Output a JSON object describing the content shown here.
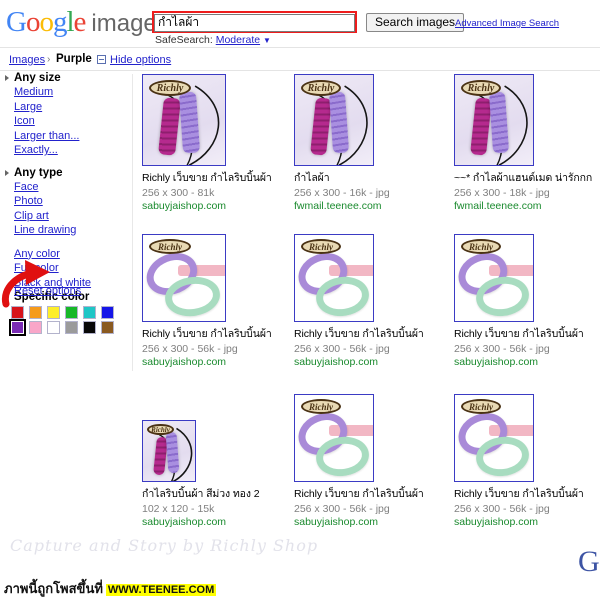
{
  "header": {
    "logo_text": "Google",
    "logo_letters": [
      "G",
      "o",
      "o",
      "g",
      "l",
      "e"
    ],
    "logo_suffix": "images",
    "search_value": "กำไลผ้า",
    "search_placeholder": "",
    "search_button": "Search images",
    "advanced_link": "Advanced Image Search",
    "safesearch_label": "SafeSearch:",
    "safesearch_value": "Moderate",
    "safesearch_caret": "▼"
  },
  "breadcrumb": {
    "root": "Images",
    "separator": "›",
    "current": "Purple",
    "hide_options": "Hide options"
  },
  "sidebar": {
    "groups": [
      {
        "head": "Any size",
        "links": [
          "Medium",
          "Large",
          "Icon",
          "Larger than...",
          "Exactly..."
        ]
      },
      {
        "head": "Any type",
        "links": [
          "Face",
          "Photo",
          "Clip art",
          "Line drawing"
        ]
      }
    ],
    "color_links": [
      "Any color",
      "Full color",
      "Black and white"
    ],
    "specific_color_head": "Specific color",
    "swatch_rows": [
      [
        {
          "name": "red",
          "hex": "#d7131a",
          "selected": false
        },
        {
          "name": "orange",
          "hex": "#f59b1b",
          "selected": false
        },
        {
          "name": "yellow",
          "hex": "#fdee2a",
          "selected": false
        },
        {
          "name": "green",
          "hex": "#17b828",
          "selected": false
        },
        {
          "name": "teal",
          "hex": "#1fc6c6",
          "selected": false
        },
        {
          "name": "blue",
          "hex": "#1515e8",
          "selected": false
        }
      ],
      [
        {
          "name": "purple",
          "hex": "#7a2bb5",
          "selected": true
        },
        {
          "name": "pink",
          "hex": "#f9a6c8",
          "selected": false
        },
        {
          "name": "white",
          "hex": "#ffffff",
          "selected": false
        },
        {
          "name": "gray",
          "hex": "#9b9b9b",
          "selected": false
        },
        {
          "name": "black",
          "hex": "#080808",
          "selected": false
        },
        {
          "name": "brown",
          "hex": "#8a5a20",
          "selected": false
        }
      ]
    ],
    "reset_options": "Reset options"
  },
  "results": [
    [
      {
        "title": "Richly เว็บขาย กำไลริบบิ้นผ้า",
        "dims": "256 x 300 - 81k",
        "site": "sabuyjaishop.com",
        "art": "bands",
        "thumb_w": 84,
        "thumb_h": 92
      },
      {
        "title": "กำไลผ้า",
        "dims": "256 x 300 - 16k - jpg",
        "site": "fwmail.teenee.com",
        "art": "bands",
        "thumb_w": 80,
        "thumb_h": 92
      },
      {
        "title": "~~* กำไลผ้าแฮนด์เมด น่ารักกก",
        "dims": "256 x 300 - 18k - jpg",
        "site": "fwmail.teenee.com",
        "art": "bands",
        "thumb_w": 80,
        "thumb_h": 92
      }
    ],
    [
      {
        "title": "Richly เว็บขาย กำไลริบบิ้นผ้า",
        "dims": "256 x 300 - 56k - jpg",
        "site": "sabuyjaishop.com",
        "art": "rings",
        "thumb_w": 84,
        "thumb_h": 88
      },
      {
        "title": "Richly เว็บขาย กำไลริบบิ้นผ้า",
        "dims": "256 x 300 - 56k - jpg",
        "site": "sabuyjaishop.com",
        "art": "rings",
        "thumb_w": 80,
        "thumb_h": 88
      },
      {
        "title": "Richly เว็บขาย กำไลริบบิ้นผ้า",
        "dims": "256 x 300 - 56k - jpg",
        "site": "sabuyjaishop.com",
        "art": "rings",
        "thumb_w": 80,
        "thumb_h": 88
      }
    ],
    [
      {
        "title": "กำไลริบบิ้นผ้า สีม่วง ทอง 2",
        "dims": "102 x 120 - 15k",
        "site": "sabuyjaishop.com",
        "art": "bands",
        "thumb_w": 54,
        "thumb_h": 62
      },
      {
        "title": "Richly เว็บขาย กำไลริบบิ้นผ้า",
        "dims": "256 x 300 - 56k - jpg",
        "site": "sabuyjaishop.com",
        "art": "rings",
        "thumb_w": 80,
        "thumb_h": 88
      },
      {
        "title": "Richly เว็บขาย กำไลริบบิ้นผ้า",
        "dims": "256 x 300 - 56k - jpg",
        "site": "sabuyjaishop.com",
        "art": "rings",
        "thumb_w": 80,
        "thumb_h": 88
      }
    ]
  ],
  "watermark": {
    "script_text": "Capture and Story by Richly Shop",
    "thai_text": "ภาพนี้ถูกโพสขึ้นที่",
    "site_badge": "WWW.TEENEE.COM",
    "corner_letter": "G"
  },
  "brand_logo_text": "Richly",
  "colors": {
    "link": "#2222cc",
    "site_green": "#1a8a2e",
    "dims_gray": "#808080",
    "highlight_red": "#ee1c1c",
    "badge_yellow": "#ffff00"
  }
}
